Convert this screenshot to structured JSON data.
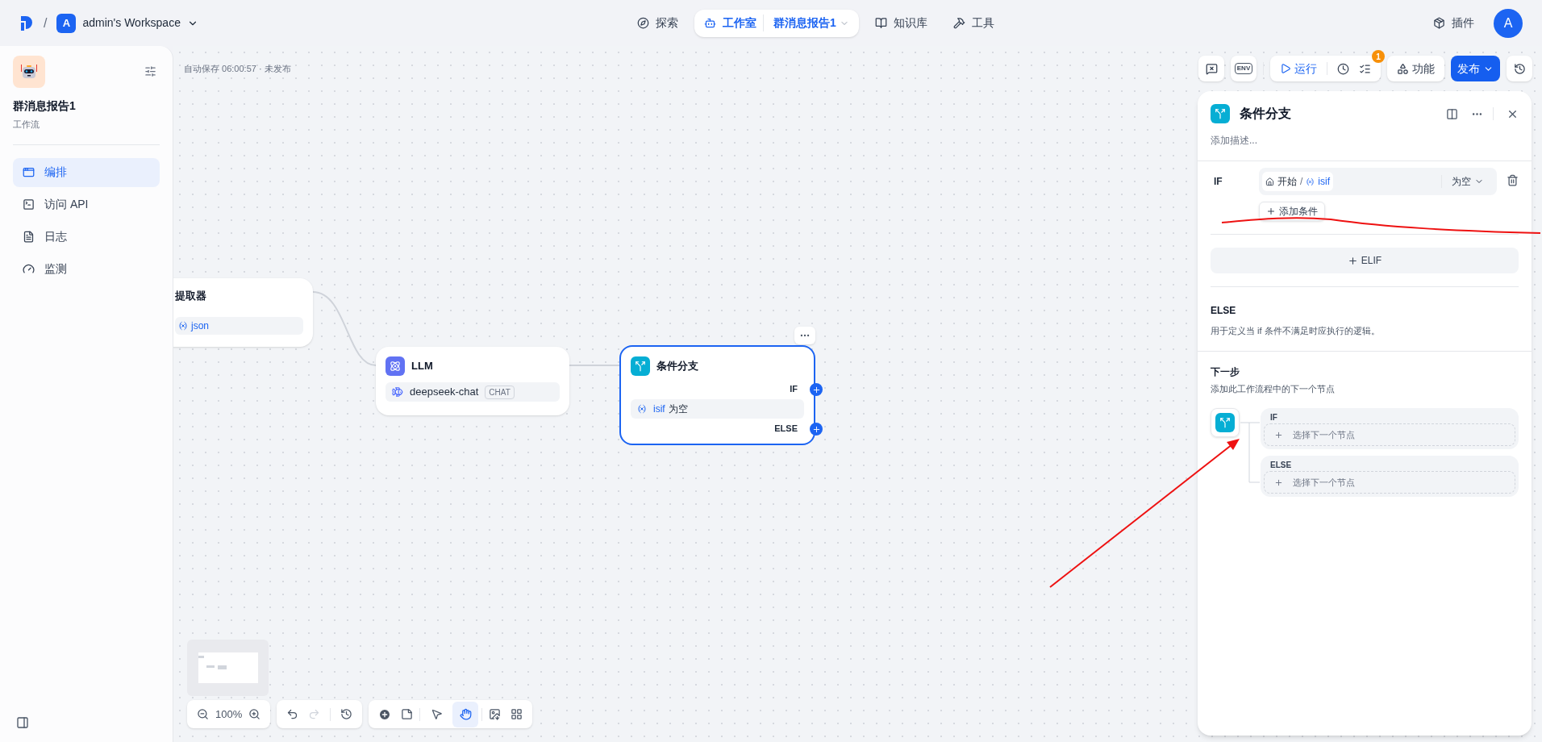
{
  "topbar": {
    "separator": "/",
    "workspace": {
      "avatar": "A",
      "name": "admin's Workspace"
    },
    "nav": [
      {
        "kind": "explore",
        "label": "探索",
        "selected": false
      },
      {
        "kind": "studio",
        "label": "工作室",
        "sub": "群消息报告1",
        "selected": true
      },
      {
        "kind": "knowledge",
        "label": "知识库",
        "selected": false
      },
      {
        "kind": "tools",
        "label": "工具",
        "selected": false
      }
    ],
    "plugins": "插件",
    "user_avatar": "A"
  },
  "sidebar": {
    "app_name": "群消息报告1",
    "app_type": "工作流",
    "items": [
      {
        "kind": "orchestrate",
        "label": "编排",
        "selected": true
      },
      {
        "kind": "api",
        "label": "访问 API",
        "selected": false
      },
      {
        "kind": "logs",
        "label": "日志",
        "selected": false
      },
      {
        "kind": "monitor",
        "label": "监测",
        "selected": false
      }
    ]
  },
  "canvas": {
    "autosave": "自动保存 06:00:57 · 未发布",
    "toolbar": {
      "env": "ENV",
      "run": "运行",
      "checklist_badge": "1",
      "features": "功能",
      "publish": "发布"
    },
    "nodes": {
      "extractor": {
        "title": "提取器",
        "variable": "json"
      },
      "llm": {
        "title": "LLM",
        "model": "deepseek-chat",
        "tag": "CHAT"
      },
      "branch": {
        "title": "条件分支",
        "if": "IF",
        "variable": "isif",
        "operator": "为空",
        "else": "ELSE"
      }
    },
    "zoom": "100%",
    "tools": [
      {
        "kind": "pointer",
        "selected": false
      },
      {
        "kind": "hand",
        "selected": true
      }
    ]
  },
  "panel": {
    "title": "条件分支",
    "description_placeholder": "添加描述...",
    "if_label": "IF",
    "condition": {
      "source": "开始",
      "separator": "/",
      "variable": "isif",
      "operator": "为空"
    },
    "add_condition": "添加条件",
    "elif": "ELIF",
    "else_title": "ELSE",
    "else_description": "用于定义当 if 条件不满足时应执行的逻辑。",
    "next_title": "下一步",
    "next_description": "添加此工作流程中的下一个节点",
    "branches": [
      {
        "label": "IF",
        "placeholder": "选择下一个节点"
      },
      {
        "label": "ELSE",
        "placeholder": "选择下一个节点"
      }
    ]
  }
}
